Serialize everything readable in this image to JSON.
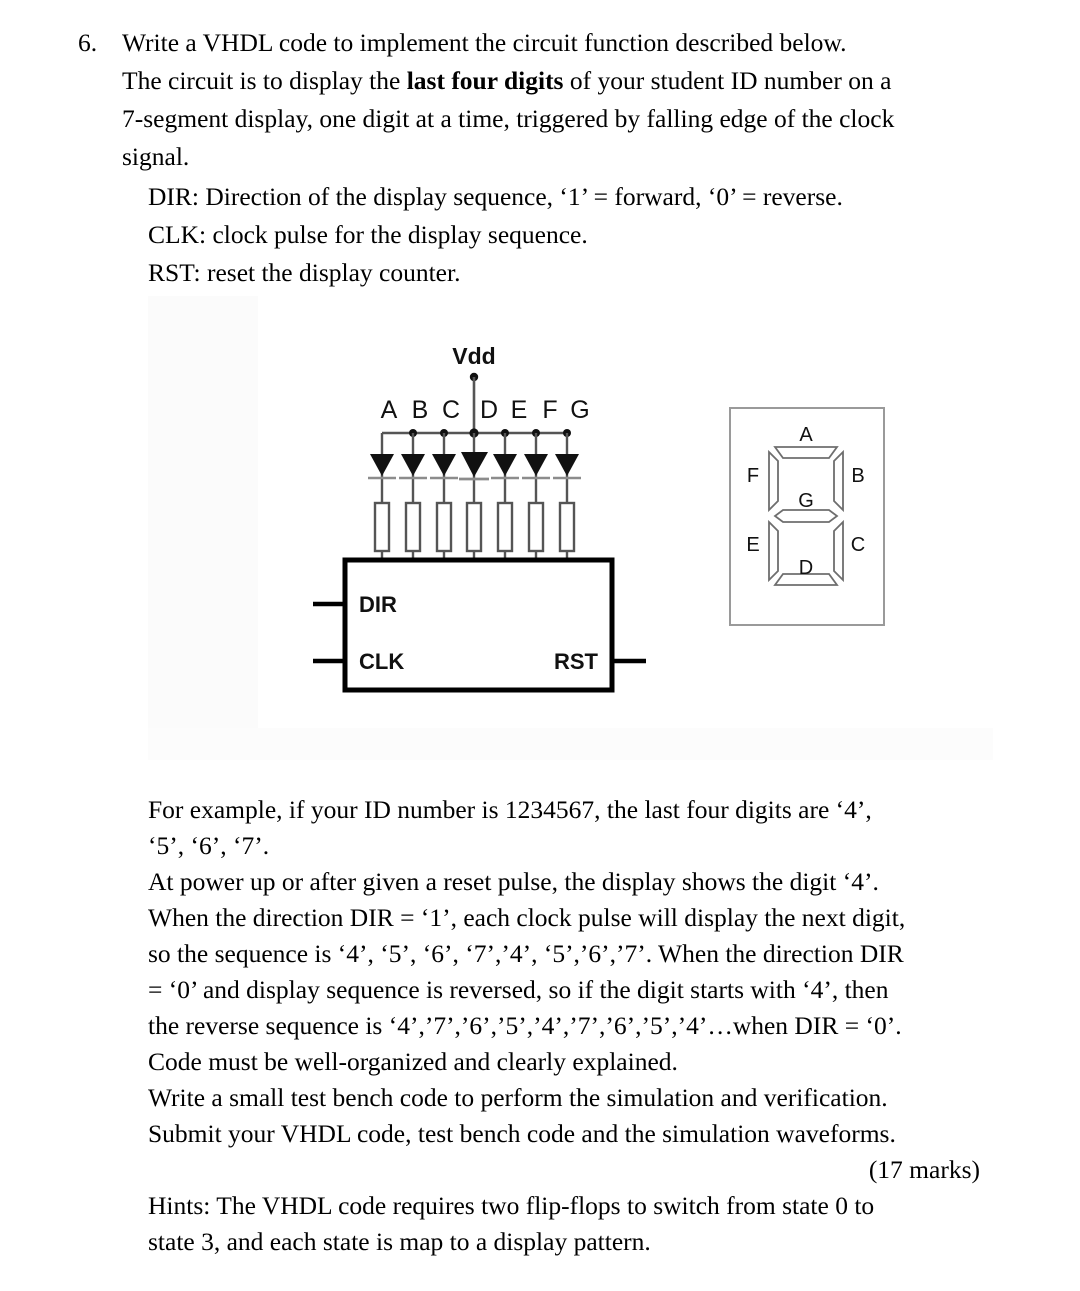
{
  "question": {
    "number": "6.",
    "intro_line1": "Write a VHDL code to implement the circuit function described below.",
    "intro_line2_pre": "The circuit is to display the ",
    "intro_line2_bold": "last four digits",
    "intro_line2_post": " of your student ID number on a",
    "intro_line3": "7-segment display, one digit at a time, triggered by falling edge of the clock",
    "intro_line4": "signal.",
    "signals": [
      "DIR: Direction of the display sequence, ‘1’ = forward, ‘0’ = reverse.",
      "CLK: clock pulse for the display sequence.",
      "RST: reset the display counter."
    ]
  },
  "figure": {
    "supply_label": "Vdd",
    "segment_labels": [
      "A",
      "B",
      "C",
      "D",
      "E",
      "F",
      "G"
    ],
    "chip_pins": {
      "dir": "DIR",
      "clk": "CLK",
      "rst": "RST"
    },
    "seven_segment": {
      "top": "A",
      "top_right": "B",
      "bottom_right": "C",
      "bottom": "D",
      "bottom_left": "E",
      "top_left": "F",
      "middle": "G"
    },
    "colors": {
      "wire": "#555555",
      "chip_outline": "#000000",
      "display_outline": "#9a9a9a",
      "segment_outline": "#6e6e6e",
      "text": "#111111"
    }
  },
  "body": {
    "example_line1": "For example, if your ID number is 1234567, the last four digits are ‘4’,",
    "example_line2": "‘5’, ‘6’, ‘7’.",
    "powerup_line": "At power up or after given a reset pulse, the display shows the digit ‘4’.",
    "forward_line1": "When the direction DIR = ‘1’, each clock pulse will display the next digit,",
    "forward_line2": "so the sequence is ‘4’, ‘5’, ‘6’, ‘7’,’4’, ‘5’,’6’,’7’. When the direction DIR",
    "reverse_line1": "= ‘0’ and display sequence is reversed, so if the digit starts with ‘4’, then",
    "reverse_line2": "the reverse sequence is  ‘4’,’7’,’6’,’5’,’4’,’7’,’6’,’5’,’4’…when DIR = ‘0’.",
    "organized_line": "Code must be well-organized and clearly explained.",
    "testbench_line": "Write a small test bench code to perform the simulation and verification.",
    "submit_line": "Submit your VHDL code, test bench code and the simulation waveforms.",
    "marks": "(17 marks)",
    "hints_line1": "Hints: The VHDL code requires two flip-flops to switch from state 0 to",
    "hints_line2": "state 3, and each state is map to a display pattern."
  }
}
